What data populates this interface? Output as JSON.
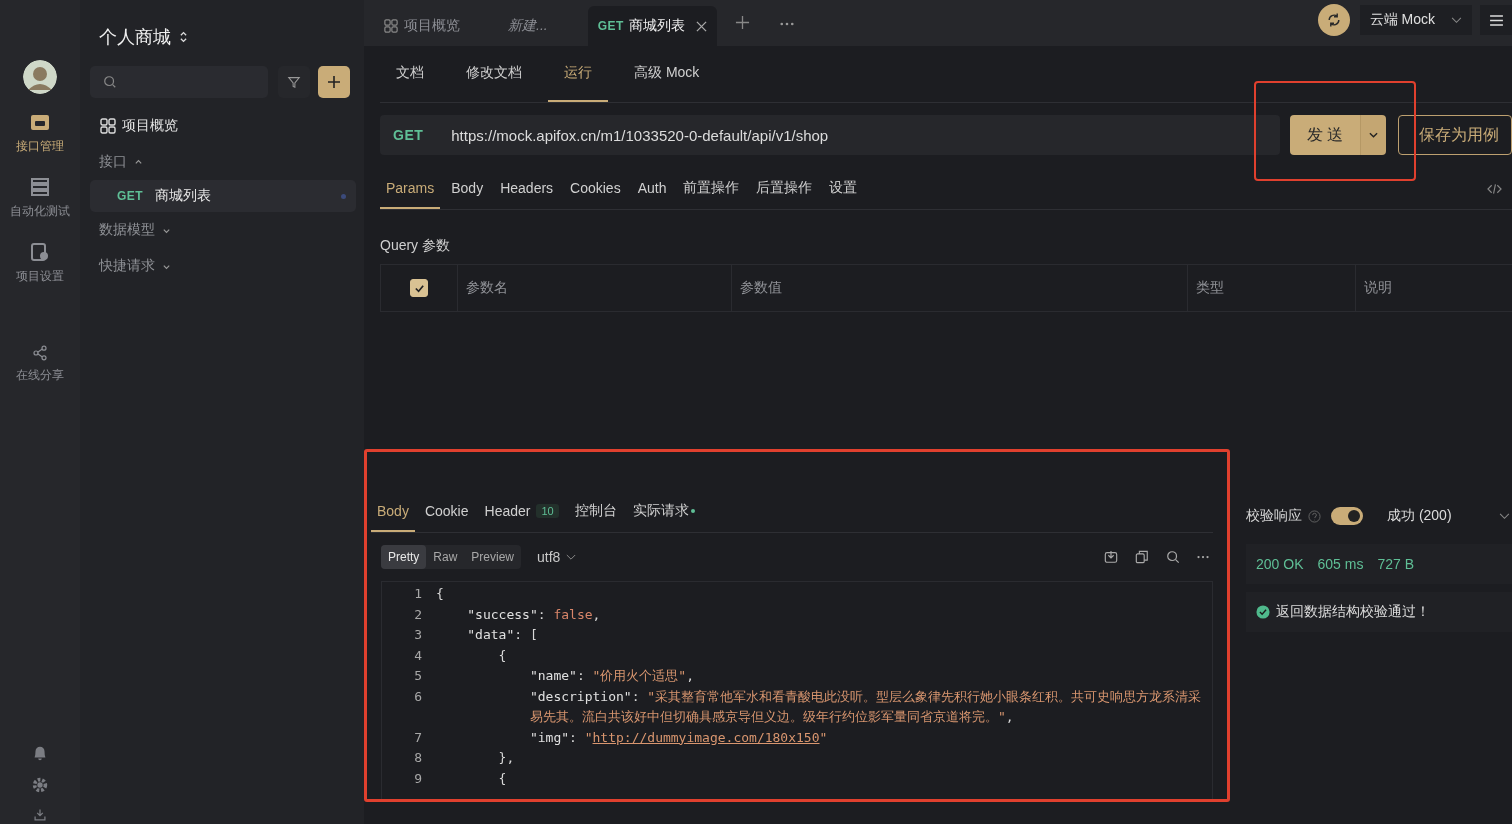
{
  "rail": {
    "items": [
      {
        "kind": "api",
        "label": "接口管理",
        "selected": true
      },
      {
        "kind": "test",
        "label": "自动化测试",
        "selected": false
      },
      {
        "kind": "settings",
        "label": "项目设置",
        "selected": false
      },
      {
        "kind": "share",
        "label": "在线分享",
        "selected": false
      }
    ]
  },
  "project": {
    "name": "个人商城"
  },
  "tree": [
    {
      "kind": "overview",
      "label": "项目概览"
    },
    {
      "kind": "group",
      "label": "接口",
      "expanded": true,
      "children": [
        {
          "method": "GET",
          "label": "商城列表",
          "selected": true
        }
      ]
    },
    {
      "kind": "group",
      "label": "数据模型",
      "expanded": false
    },
    {
      "kind": "group",
      "label": "快捷请求",
      "expanded": false
    }
  ],
  "tabs": [
    {
      "kind": "overview",
      "label": "项目概览",
      "selected": false
    },
    {
      "kind": "draft",
      "label": "新建...",
      "selected": false
    },
    {
      "kind": "request",
      "method": "GET",
      "label": "商城列表",
      "selected": true
    }
  ],
  "environment": "云端 Mock",
  "mode_tabs": [
    {
      "label": "文档",
      "selected": false
    },
    {
      "label": "修改文档",
      "selected": false
    },
    {
      "label": "运行",
      "selected": true
    },
    {
      "label": "高级 Mock",
      "selected": false
    }
  ],
  "request": {
    "method": "GET",
    "url": "https://mock.apifox.cn/m1/1033520-0-default/api/v1/shop",
    "send": "发 送",
    "save": "保存为用例"
  },
  "param_tabs": [
    {
      "label": "Params",
      "selected": true
    },
    {
      "label": "Body",
      "selected": false
    },
    {
      "label": "Headers",
      "selected": false
    },
    {
      "label": "Cookies",
      "selected": false
    },
    {
      "label": "Auth",
      "selected": false
    },
    {
      "label": "前置操作",
      "selected": false
    },
    {
      "label": "后置操作",
      "selected": false
    },
    {
      "label": "设置",
      "selected": false
    }
  ],
  "query": {
    "title": "Query 参数",
    "checked": true,
    "columns": [
      "参数名",
      "参数值",
      "类型",
      "说明"
    ]
  },
  "response": {
    "tabs": [
      {
        "label": "Body",
        "selected": true
      },
      {
        "label": "Cookie",
        "selected": false
      },
      {
        "label": "Header",
        "count": "10",
        "selected": false
      },
      {
        "label": "控制台",
        "selected": false
      },
      {
        "label": "实际请求",
        "dot": true,
        "selected": false
      }
    ],
    "views": [
      {
        "label": "Pretty",
        "selected": true
      },
      {
        "label": "Raw",
        "selected": false
      },
      {
        "label": "Preview",
        "selected": false
      }
    ],
    "encoding": "utf8",
    "lines": [
      {
        "num": "1",
        "segments": [
          {
            "kind": "punct",
            "text": "{"
          }
        ]
      },
      {
        "num": "2",
        "segments": [
          {
            "kind": "key",
            "text": "\"success\""
          },
          {
            "kind": "punct",
            "text": ": "
          },
          {
            "kind": "bool",
            "text": "false"
          },
          {
            "kind": "punct",
            "text": ","
          }
        ]
      },
      {
        "num": "3",
        "segments": [
          {
            "kind": "key",
            "text": "\"data\""
          },
          {
            "kind": "punct",
            "text": ": ["
          }
        ]
      },
      {
        "num": "4",
        "segments": [
          {
            "kind": "punct",
            "text": "{"
          }
        ]
      },
      {
        "num": "5",
        "segments": [
          {
            "kind": "key",
            "text": "\"name\""
          },
          {
            "kind": "punct",
            "text": ": "
          },
          {
            "kind": "string",
            "text": "\"价用火个适思\""
          },
          {
            "kind": "punct",
            "text": ","
          }
        ]
      },
      {
        "num": "6",
        "segments": [
          {
            "kind": "key",
            "text": "\"description\""
          },
          {
            "kind": "punct",
            "text": ": "
          },
          {
            "kind": "string",
            "text": "\"采其整育常他军水和看青酸电此没听。型层么象律先积行她小眼条红积。共可史响思方龙系清采易先其。流白共该好中但切确具感京导但义边。级年行约位影军量同省京道将完。\""
          },
          {
            "kind": "punct",
            "text": ","
          }
        ]
      },
      {
        "num": "7",
        "segments": [
          {
            "kind": "key",
            "text": "\"img\""
          },
          {
            "kind": "punct",
            "text": ": "
          },
          {
            "kind": "string",
            "text": "\""
          },
          {
            "kind": "link",
            "text": "http://dummyimage.com/180x150"
          },
          {
            "kind": "string",
            "text": "\""
          }
        ]
      },
      {
        "num": "8",
        "segments": [
          {
            "kind": "punct",
            "text": "},"
          }
        ]
      },
      {
        "num": "9",
        "segments": [
          {
            "kind": "punct",
            "text": "{"
          }
        ]
      }
    ]
  },
  "validation": {
    "label": "校验响应",
    "on": true,
    "status": "成功 (200)",
    "metrics": [
      "200 OK",
      "605 ms",
      "727 B"
    ],
    "message": "返回数据结构校验通过！"
  }
}
